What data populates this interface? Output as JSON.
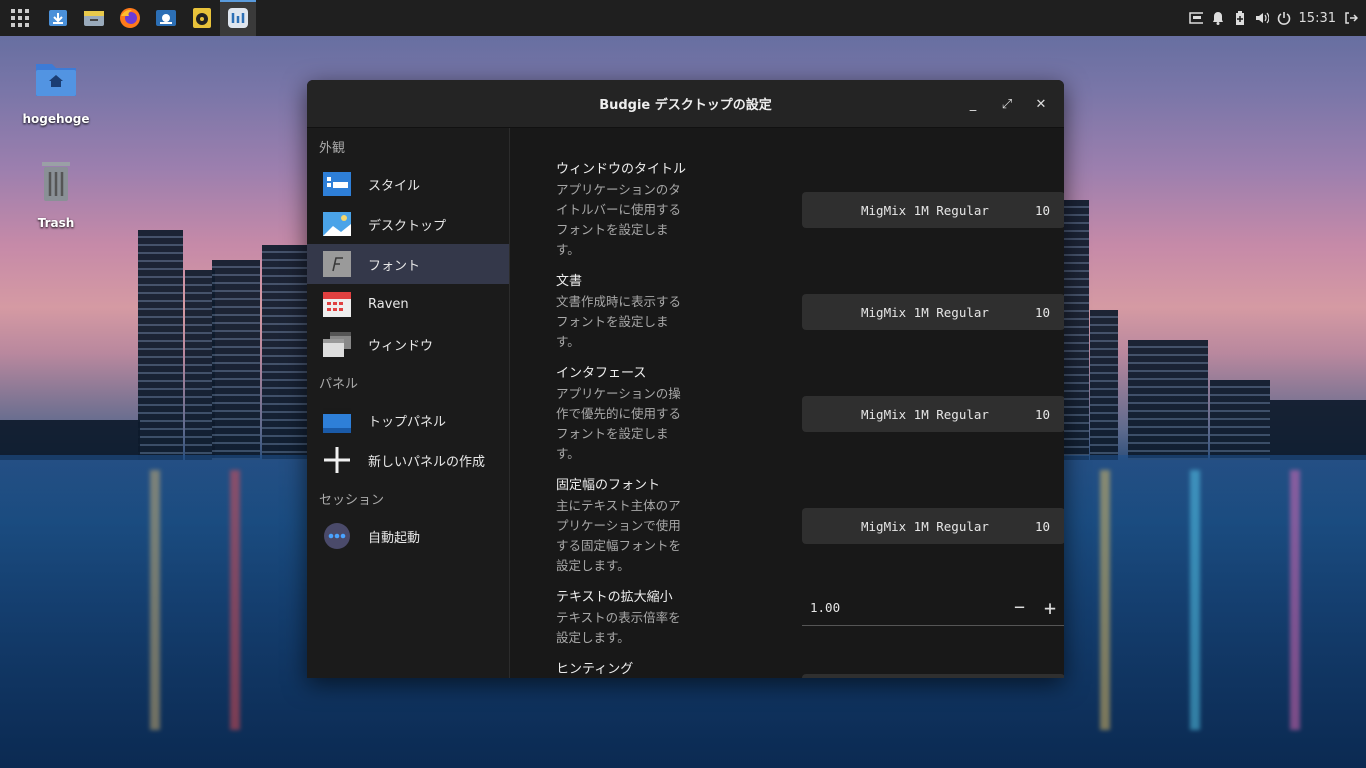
{
  "taskbar": {
    "apps": [
      "app-grid-icon",
      "download-icon",
      "file-manager-icon",
      "firefox-icon",
      "system-monitor-icon",
      "rhythmbox-icon",
      "budgie-settings-icon"
    ],
    "clock": "15:31"
  },
  "desktop": {
    "icons": [
      {
        "label": "hogehoge"
      },
      {
        "label": "Trash"
      }
    ]
  },
  "window": {
    "title": "Budgie デスクトップの設定",
    "controls": {
      "minimize": "_",
      "maximize": "⤢",
      "close": "✕"
    }
  },
  "sidebar": {
    "sections": [
      {
        "header": "外観",
        "items": [
          "スタイル",
          "デスクトップ",
          "フォント",
          "Raven",
          "ウィンドウ"
        ]
      },
      {
        "header": "パネル",
        "items": [
          "トップパネル",
          "新しいパネルの作成"
        ]
      },
      {
        "header": "セッション",
        "items": [
          "自動起動"
        ]
      }
    ],
    "selected": "フォント"
  },
  "content": {
    "rows": [
      {
        "label": "ウィンドウのタイトル",
        "desc": "アプリケーションのタイトルバーに使用するフォントを設定します。",
        "font": "MigMix 1M Regular",
        "size": "10"
      },
      {
        "label": "文書",
        "desc": "文書作成時に表示するフォントを設定します。",
        "font": "MigMix 1M Regular",
        "size": "10"
      },
      {
        "label": "インタフェース",
        "desc": "アプリケーションの操作で優先的に使用するフォントを設定します。",
        "font": "MigMix 1M Regular",
        "size": "10"
      },
      {
        "label": "固定幅のフォント",
        "desc": "主にテキスト主体のアプリケーションで使用する固定幅フォントを設定します。",
        "font": "MigMix 1M Regular",
        "size": "10"
      },
      {
        "label": "テキストの拡大縮小",
        "desc": "テキストの表示倍率を設定します。",
        "value": "1.00"
      },
      {
        "label": "ヒンティング"
      }
    ]
  }
}
